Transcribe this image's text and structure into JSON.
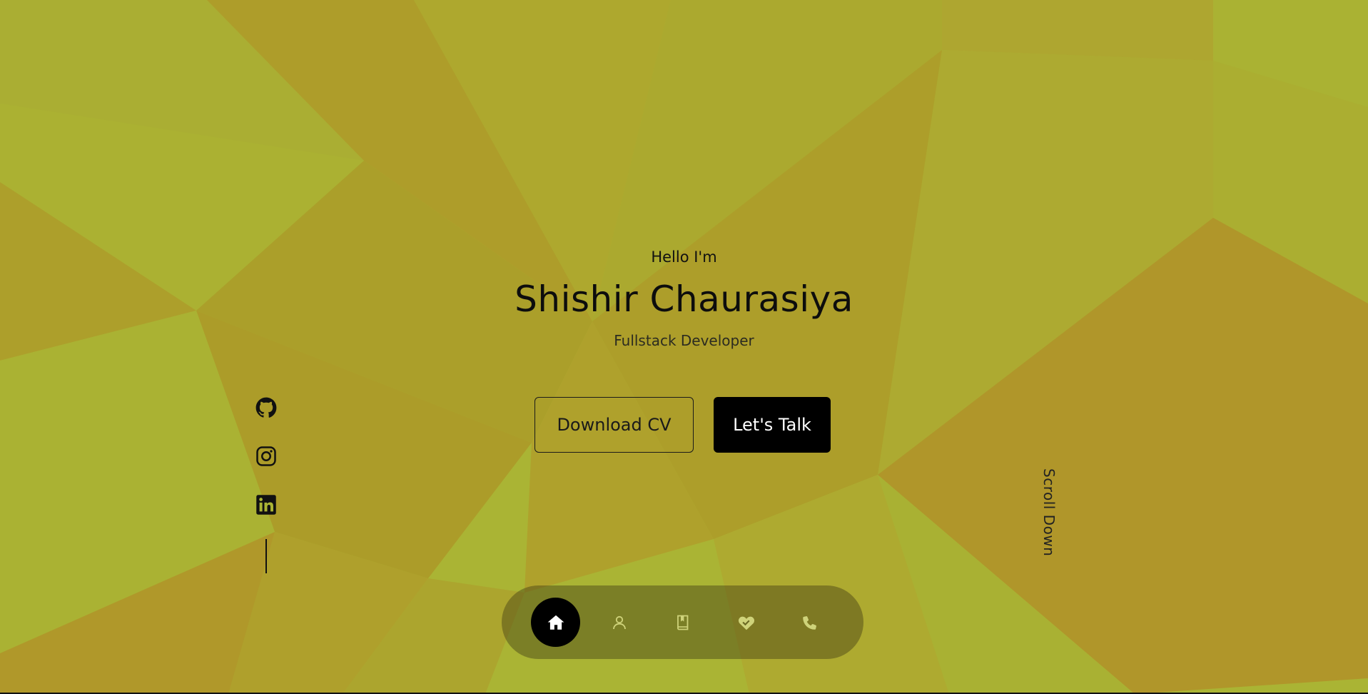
{
  "hero": {
    "greeting": "Hello I'm",
    "name": "Shishir Chaurasiya",
    "role": "Fullstack Developer"
  },
  "buttons": {
    "download_cv": "Download CV",
    "lets_talk": "Let's Talk"
  },
  "socials": [
    {
      "icon": "github-icon"
    },
    {
      "icon": "instagram-icon"
    },
    {
      "icon": "linkedin-icon"
    }
  ],
  "scroll": {
    "label": "Scroll Down"
  },
  "nav": {
    "items": [
      {
        "icon": "home-icon",
        "active": true
      },
      {
        "icon": "user-icon",
        "active": false
      },
      {
        "icon": "book-icon",
        "active": false
      },
      {
        "icon": "handshake-icon",
        "active": false
      },
      {
        "icon": "phone-icon",
        "active": false
      }
    ]
  },
  "colors": {
    "background": "#aab434",
    "accent_dark": "#000000",
    "nav_bar": "#5f5a1e"
  }
}
